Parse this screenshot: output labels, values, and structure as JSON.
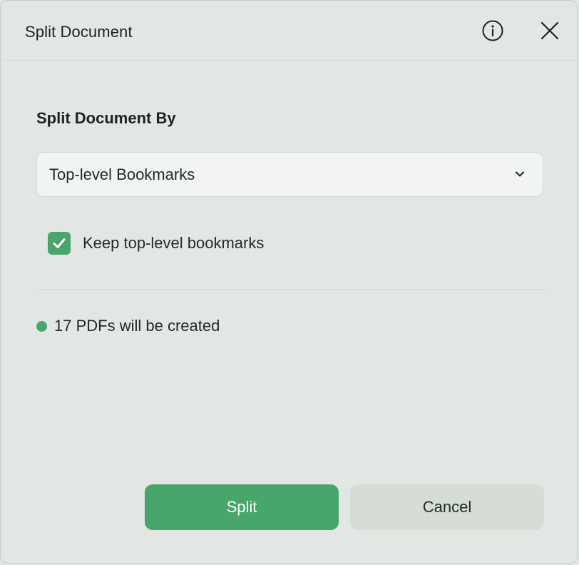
{
  "dialog": {
    "title": "Split Document",
    "info_icon": "info-icon",
    "close_icon": "close-icon"
  },
  "split_by": {
    "label": "Split Document By",
    "selected": "Top-level Bookmarks",
    "chevron_icon": "chevron-down-icon"
  },
  "option": {
    "checked": true,
    "label": "Keep top-level bookmarks"
  },
  "status": {
    "text": "17 PDFs will be created",
    "color": "#48a56c"
  },
  "buttons": {
    "primary_label": "Split",
    "secondary_label": "Cancel"
  },
  "colors": {
    "accent": "#48a56c",
    "background": "#e2e7e3"
  }
}
